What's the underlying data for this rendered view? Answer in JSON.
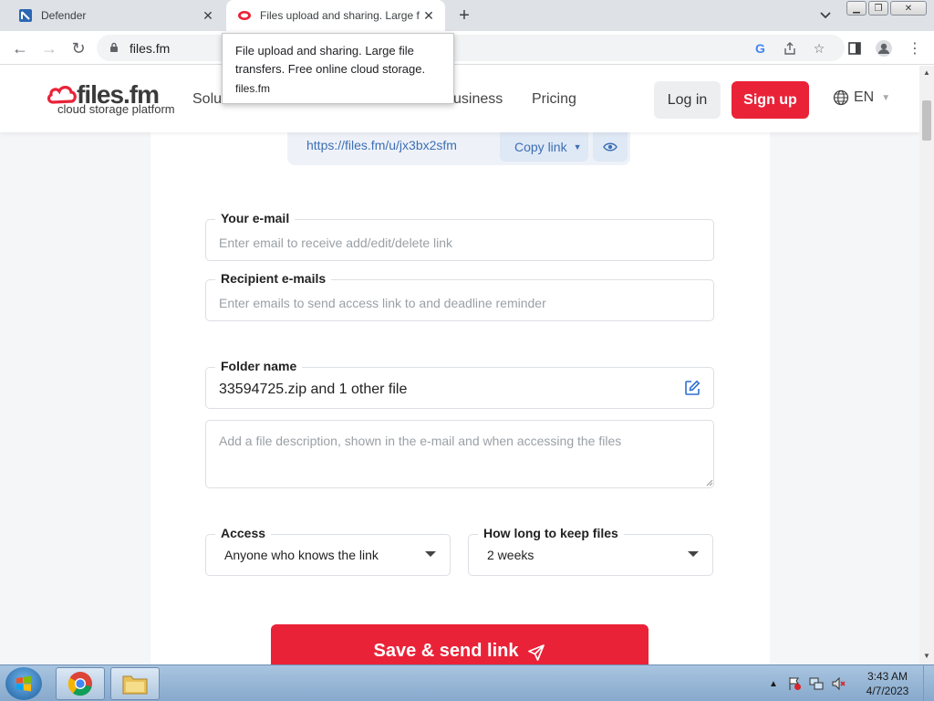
{
  "browser": {
    "tabs": [
      {
        "title": "Defender",
        "active": false
      },
      {
        "title": "Files upload and sharing. Large files",
        "active": true
      }
    ],
    "new_tab": "+",
    "url": "files.fm",
    "tooltip": {
      "title": "File upload and sharing. Large file transfers. Free online cloud storage.",
      "domain": "files.fm"
    }
  },
  "site": {
    "logo_text": "files.fm",
    "logo_sub": "cloud storage platform",
    "nav": [
      "Solu",
      "usiness",
      "Pricing"
    ],
    "login": "Log in",
    "signup": "Sign up",
    "lang": "EN"
  },
  "share": {
    "link": "https://files.fm/u/jx3bx2sfm",
    "copy_label": "Copy link"
  },
  "form": {
    "email": {
      "label": "Your e-mail",
      "placeholder": "Enter email to receive add/edit/delete link"
    },
    "recipients": {
      "label": "Recipient e-mails",
      "placeholder": "Enter emails to send access link to and deadline reminder"
    },
    "folder": {
      "label": "Folder name",
      "value": "33594725.zip and 1 other file"
    },
    "description": {
      "placeholder": "Add a file description, shown in the e-mail and when accessing the files"
    },
    "access": {
      "label": "Access",
      "value": "Anyone who knows the link"
    },
    "keep": {
      "label": "How long to keep files",
      "value": "2 weeks"
    },
    "save": "Save & send link"
  },
  "taskbar": {
    "time": "3:43 AM",
    "date": "4/7/2023"
  },
  "colors": {
    "brand_red": "#ea2238",
    "link_blue": "#3d6fb4"
  }
}
